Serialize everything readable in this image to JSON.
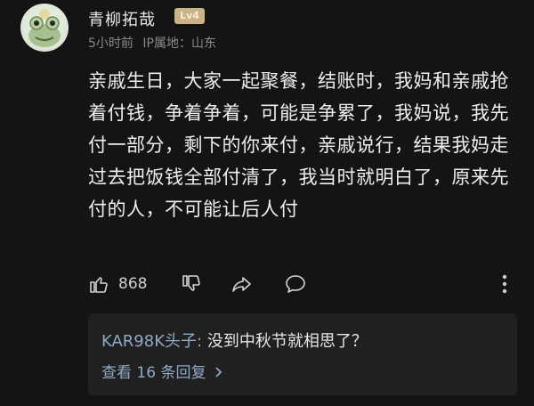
{
  "comment": {
    "username": "青柳拓哉",
    "level_badge": "Lv4",
    "time": "5小时前",
    "ip_location": "IP属地：山东",
    "content": "亲戚生日，大家一起聚餐，结账时，我妈和亲戚抢着付钱，争着争着，可能是争累了，我妈说，我先付一部分，剩下的你来付，亲戚说行，结果我妈走过去把饭钱全部付清了，我当时就明白了，原来先付的人，不可能让后人付",
    "like_count": "868"
  },
  "reply_preview": {
    "username": "KAR98K头子:",
    "text": " 没到中秋节就相思了？",
    "view_more": "查看 16 条回复"
  },
  "colors": {
    "background": "#141414",
    "link_blue": "#8fa9c6",
    "badge_gold": "#c9b387"
  },
  "icons": [
    "avatar-frog",
    "thumbs-up-icon",
    "thumbs-down-icon",
    "share-icon",
    "comment-icon",
    "more-icon",
    "chevron-right-icon"
  ]
}
